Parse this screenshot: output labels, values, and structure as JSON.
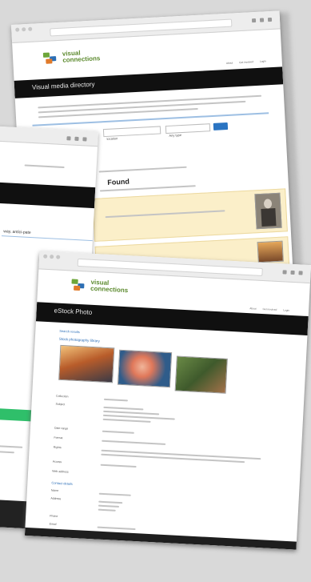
{
  "screen1": {
    "logo_line1": "visual",
    "logo_line2": "connections",
    "nav_title": "Visual media directory",
    "menu": [
      "About",
      "Get involved",
      "Login"
    ],
    "search_placeholder": "location",
    "select_value": "Any type",
    "search_button": "Search",
    "section_heading": "Found",
    "colors": {
      "accent": "#2a74c2",
      "nav": "#101010",
      "result": "#fbefc9"
    }
  },
  "screen2": {
    "nav_title": "",
    "left_text": "way, antici-pate",
    "button": "Go"
  },
  "screen3": {
    "logo_line1": "visual",
    "logo_line2": "connections",
    "nav_title": "eStock Photo",
    "menu": [
      "About",
      "Get involved",
      "Login"
    ],
    "breadcrumb": "Search results",
    "record_title": "Stock photography library",
    "field_labels": [
      "Collection",
      "Subject",
      "Date range",
      "Format",
      "Rights",
      "Access",
      "Web address"
    ],
    "section_heading": "Contact details",
    "contact_labels": [
      "Name",
      "Address",
      "Phone",
      "Email"
    ]
  }
}
